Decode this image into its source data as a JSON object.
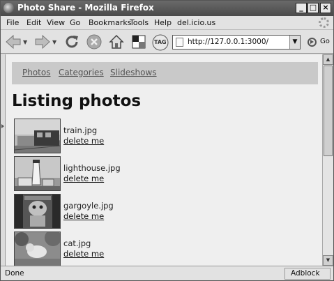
{
  "window": {
    "title": "Photo Share - Mozilla Firefox"
  },
  "menubar": {
    "items": [
      "File",
      "Edit",
      "View",
      "Go",
      "Bookmarks",
      "Tools",
      "Help",
      "del.icio.us"
    ]
  },
  "toolbar": {
    "tag_label": "TAG",
    "url": "http://127.0.0.1:3000/",
    "go_label": "Go"
  },
  "page": {
    "nav": [
      "Photos",
      "Categories",
      "Slideshows"
    ],
    "heading": "Listing photos",
    "photos": [
      {
        "filename": "train.jpg",
        "action": "delete me"
      },
      {
        "filename": "lighthouse.jpg",
        "action": "delete me"
      },
      {
        "filename": "gargoyle.jpg",
        "action": "delete me"
      },
      {
        "filename": "cat.jpg",
        "action": "delete me"
      }
    ]
  },
  "statusbar": {
    "status": "Done",
    "addon": "Adblock"
  }
}
